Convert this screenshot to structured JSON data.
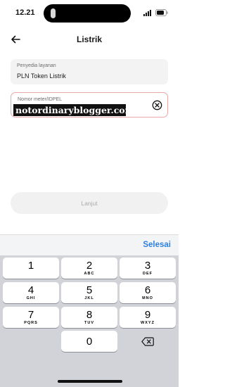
{
  "status_bar": {
    "time": "12.21"
  },
  "header": {
    "title": "Listrik"
  },
  "provider_field": {
    "label": "Penyedia layanan",
    "value": "PLN Token Listrik"
  },
  "meter_field": {
    "label": "Nomor meter/IDPEL",
    "value": "notordinaryblogger.com"
  },
  "next_button": {
    "label": "Lanjut"
  },
  "keyboard_toolbar": {
    "done_label": "Selesai"
  },
  "keyboard": {
    "keys": [
      {
        "digit": "1",
        "letters": ""
      },
      {
        "digit": "2",
        "letters": "ABC"
      },
      {
        "digit": "3",
        "letters": "DEF"
      },
      {
        "digit": "4",
        "letters": "GHI"
      },
      {
        "digit": "5",
        "letters": "JKL"
      },
      {
        "digit": "6",
        "letters": "MNO"
      },
      {
        "digit": "7",
        "letters": "PQRS"
      },
      {
        "digit": "8",
        "letters": "TUV"
      },
      {
        "digit": "9",
        "letters": "WXYZ"
      },
      {
        "digit": "0",
        "letters": ""
      }
    ]
  },
  "colors": {
    "accent": "#2f7fe0",
    "error_border": "#e8a8a6",
    "keyboard_bg": "#d1d3d9",
    "disabled_button": "#f1f1f1"
  }
}
